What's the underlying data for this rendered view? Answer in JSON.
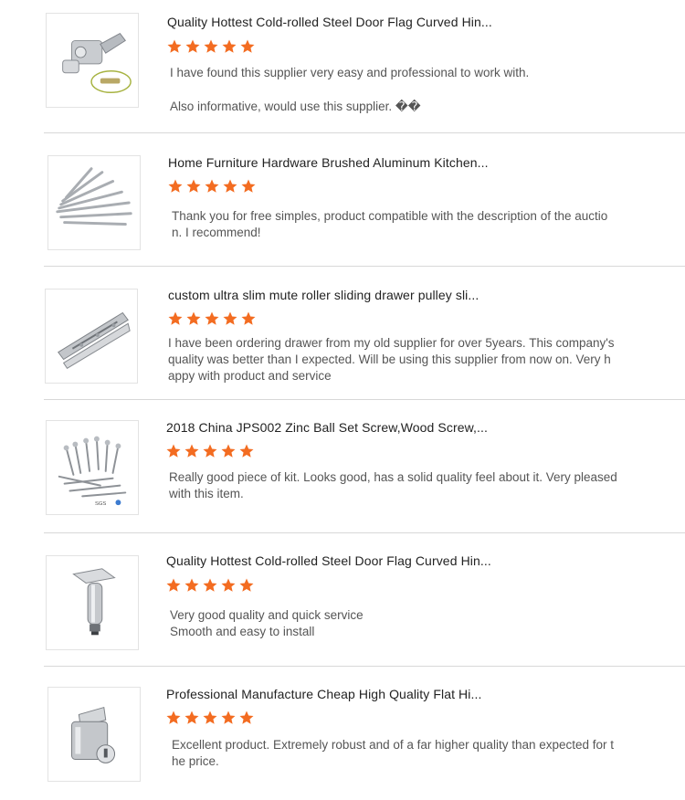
{
  "colors": {
    "star": "#f36c21",
    "divider": "#d8d8d8"
  },
  "reviews": [
    {
      "product_title": "Quality Hottest Cold-rolled Steel Door Flag Curved Hin...",
      "rating": 5,
      "image": "hinge-image",
      "comment_lines": [
        "I have found this supplier very easy and professional to work with.",
        "",
        "Also informative, would use this supplier. ��"
      ]
    },
    {
      "product_title": "Home Furniture Hardware Brushed Aluminum Kitchen...",
      "rating": 5,
      "image": "handle-bars-image",
      "comment_lines": [
        "Thank you for free simples, product compatible with the description of the auctio",
        "n.  I recommend!"
      ]
    },
    {
      "product_title": "custom ultra slim mute roller sliding drawer pulley sli...",
      "rating": 5,
      "image": "drawer-slide-image",
      "comment_lines": [
        "I have been ordering drawer from my old supplier for over 5years. This company's",
        "quality was better than I expected. Will be using this supplier from now on. Very h",
        "appy with product and service"
      ]
    },
    {
      "product_title": "2018 China JPS002 Zinc Ball Set Screw,Wood Screw,...",
      "rating": 5,
      "image": "screws-image",
      "image_caption": "SGS",
      "comment_lines": [
        "Really good piece of kit. Looks good, has a solid quality feel about it. Very pleased",
        "with this item."
      ]
    },
    {
      "product_title": "Quality Hottest Cold-rolled Steel Door Flag Curved Hin...",
      "rating": 5,
      "image": "furniture-leg-image",
      "comment_lines": [
        "Very good quality and quick service",
        "Smooth and easy to install"
      ]
    },
    {
      "product_title": "Professional Manufacture Cheap High Quality Flat Hi...",
      "rating": 5,
      "image": "drawer-lock-image",
      "comment_lines": [
        "Excellent product. Extremely robust and of a far higher quality than expected for t",
        "he price."
      ]
    }
  ]
}
